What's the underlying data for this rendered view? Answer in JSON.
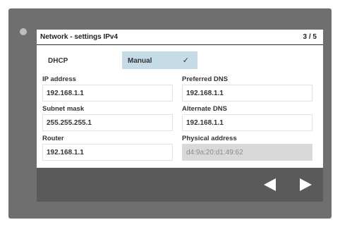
{
  "header": {
    "title": "Network - settings IPv4",
    "page_indicator": "3 / 5"
  },
  "dhcp": {
    "label": "DHCP",
    "value": "Manual",
    "check_icon": "✓"
  },
  "fields": {
    "ip_address": {
      "label": "IP address",
      "value": "192.168.1.1"
    },
    "subnet_mask": {
      "label": "Subnet mask",
      "value": "255.255.255.1"
    },
    "router": {
      "label": "Router",
      "value": "192.168.1.1"
    },
    "preferred_dns": {
      "label": "Preferred DNS",
      "value": "192.168.1.1"
    },
    "alternate_dns": {
      "label": "Alternate DNS",
      "value": "192.168.1.1"
    },
    "physical_address": {
      "label": "Physical address",
      "value": "d4:9a:20:d1:49:62"
    }
  },
  "nav": {
    "back_icon": "triangle-left-icon",
    "forward_icon": "triangle-right-icon"
  },
  "colors": {
    "bezel": "#6f6f6f",
    "nav_bar": "#5a5a5a",
    "dhcp_highlight": "#c6dbe8",
    "readonly_field": "#d9d9d9"
  }
}
